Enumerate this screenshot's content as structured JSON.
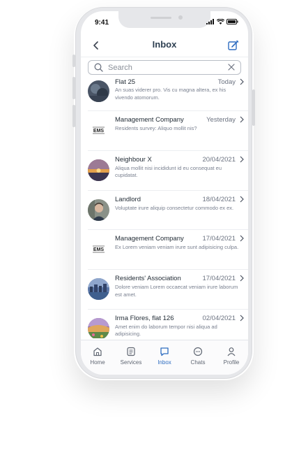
{
  "status_bar": {
    "time": "9:41"
  },
  "header": {
    "title": "Inbox"
  },
  "search": {
    "placeholder": "Search",
    "value": ""
  },
  "messages": [
    {
      "name": "Flat 25",
      "date": "Today",
      "preview": "An suas viderer pro. Vis cu magna altera, ex his vivendo atomorum.",
      "avatar": "photo-avatar"
    },
    {
      "name": "Management Company",
      "date": "Yesterday",
      "preview": "Residents survey: Aliquo mollit nis?",
      "avatar": "ems-logo"
    },
    {
      "name": "Neighbour X",
      "date": "20/04/2021",
      "preview": "Aliqua mollit nisi incididunt id eu consequat eu cupidatat.",
      "avatar": "sunset-avatar"
    },
    {
      "name": "Landlord",
      "date": "18/04/2021",
      "preview": "Voluptate irure aliquip consectetur commodo ex ex.",
      "avatar": "person-avatar"
    },
    {
      "name": "Management Company",
      "date": "17/04/2021",
      "preview": "Ex Lorem veniam veniam irure sunt adipisicing culpa.",
      "avatar": "ems-logo"
    },
    {
      "name": "Residents' Association",
      "date": "17/04/2021",
      "preview": "Dolore veniam Lorem occaecat veniam irure laborum est amet.",
      "avatar": "city-avatar"
    },
    {
      "name": "Irma Flores, flat 126",
      "date": "02/04/2021",
      "preview": "Amet enim do laborum tempor nisi aliqua ad adipisicing.",
      "avatar": "flowers-avatar"
    }
  ],
  "logo_text": "EMS",
  "tabs": [
    {
      "label": "Home",
      "icon": "home-icon",
      "active": false
    },
    {
      "label": "Services",
      "icon": "services-icon",
      "active": false
    },
    {
      "label": "Inbox",
      "icon": "inbox-icon",
      "active": true
    },
    {
      "label": "Chats",
      "icon": "chats-icon",
      "active": false
    },
    {
      "label": "Profile",
      "icon": "profile-icon",
      "active": false
    }
  ],
  "colors": {
    "accent": "#2d6cc0",
    "title": "#2c3e50",
    "muted": "#7a8190"
  }
}
